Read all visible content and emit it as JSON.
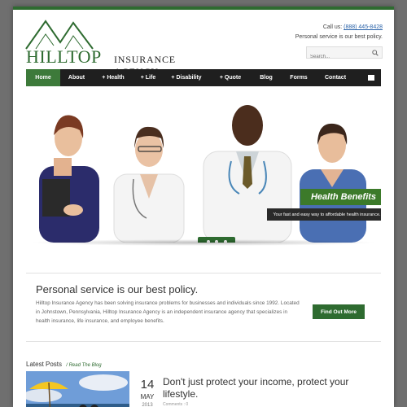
{
  "header": {
    "logo_main": "HILLTOP",
    "logo_sub": "INSURANCE AGENCY",
    "call_prefix": "Call us:",
    "phone": "(888) 445-8428",
    "tagline": "Personal service is our best policy.",
    "search_placeholder": "Search..."
  },
  "nav": {
    "items": [
      "Home",
      "About",
      "+ Health",
      "+ Life",
      "+ Disability",
      "+ Quote",
      "Blog",
      "Forms",
      "Contact"
    ],
    "active": "Home"
  },
  "hero": {
    "title": "Health Benefits",
    "subtitle": "Your fast and easy way to affordable health insurance.",
    "slide_count": 3,
    "active_slide": 1
  },
  "intro": {
    "heading": "Personal service is our best policy.",
    "body": "Hilltop Insurance Agency has been solving insurance problems for businesses and individuals since 1992. Located in Johnstown, Pennsylvania, Hilltop Insurance Agency is an independent insurance agency that specializes in health insurance, life insurance, and employee benefits.",
    "button": "Find Out More"
  },
  "latest": {
    "label": "Latest Posts",
    "link": "/ Read The Blog",
    "post": {
      "day": "14",
      "month": "MAY",
      "year": "2013",
      "title": "Don't just protect your income, protect your lifestyle.",
      "meta": "Comments : 0"
    }
  },
  "colors": {
    "brand_green": "#2e6b30",
    "nav_bg": "#1f1f1f",
    "link_blue": "#2a62a8"
  }
}
